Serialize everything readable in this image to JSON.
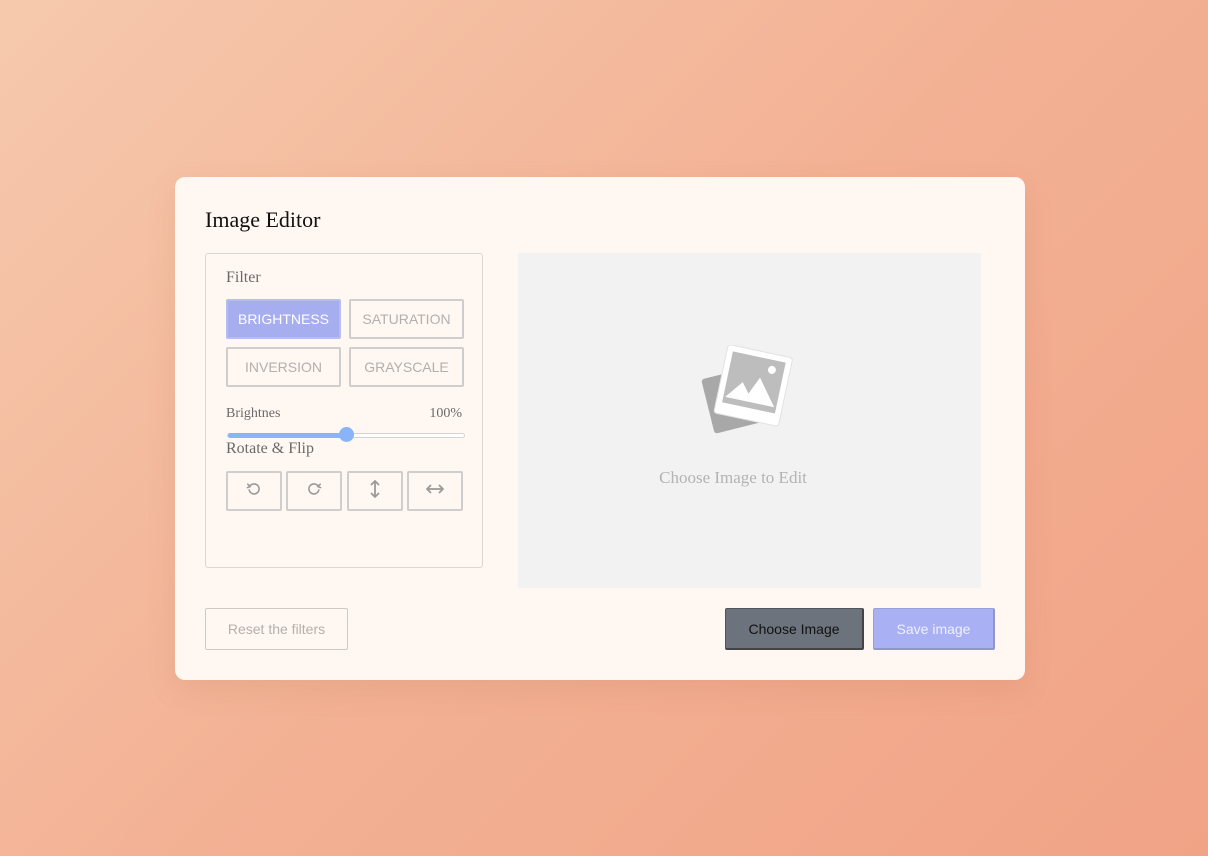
{
  "app": {
    "title": "Image Editor"
  },
  "filter": {
    "label": "Filter",
    "options": [
      {
        "label": "BRIGHTNESS",
        "active": true
      },
      {
        "label": "SATURATION",
        "active": false
      },
      {
        "label": "INVERSION",
        "active": false
      },
      {
        "label": "GRAYSCALE",
        "active": false
      }
    ]
  },
  "slider": {
    "name": "Brightnes",
    "value_text": "100%",
    "value": 100,
    "max": 200
  },
  "rotate_flip": {
    "label": "Rotate & Flip",
    "buttons": [
      {
        "icon": "rotate-left-icon"
      },
      {
        "icon": "rotate-right-icon"
      },
      {
        "icon": "flip-vertical-icon"
      },
      {
        "icon": "flip-horizontal-icon"
      }
    ]
  },
  "preview": {
    "placeholder_text": "Choose Image to Edit",
    "icon": "image-placeholder-icon"
  },
  "actions": {
    "reset_label": "Reset the filters",
    "choose_label": "Choose Image",
    "save_label": "Save image"
  },
  "colors": {
    "accent": "#a6aef0",
    "slider": "#8ab4f8",
    "choose_button": "#6c737d"
  }
}
